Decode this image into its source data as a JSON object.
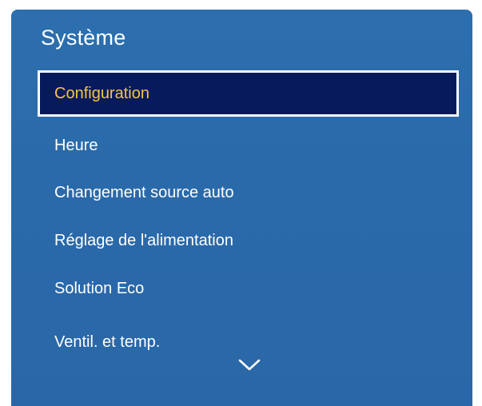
{
  "panel": {
    "title": "Système"
  },
  "menu": {
    "items": [
      {
        "label": "Configuration",
        "selected": true
      },
      {
        "label": "Heure",
        "selected": false
      },
      {
        "label": "Changement source auto",
        "selected": false
      },
      {
        "label": "Réglage de l'alimentation",
        "selected": false
      },
      {
        "label": "Solution Eco",
        "selected": false
      },
      {
        "label": "Ventil. et temp.",
        "selected": false
      }
    ],
    "more_icon": "chevron-down-icon"
  },
  "colors": {
    "panel_background": "#2a6aaa",
    "selected_background": "#071a5c",
    "selected_text": "#f5c542",
    "text": "#ffffff"
  }
}
